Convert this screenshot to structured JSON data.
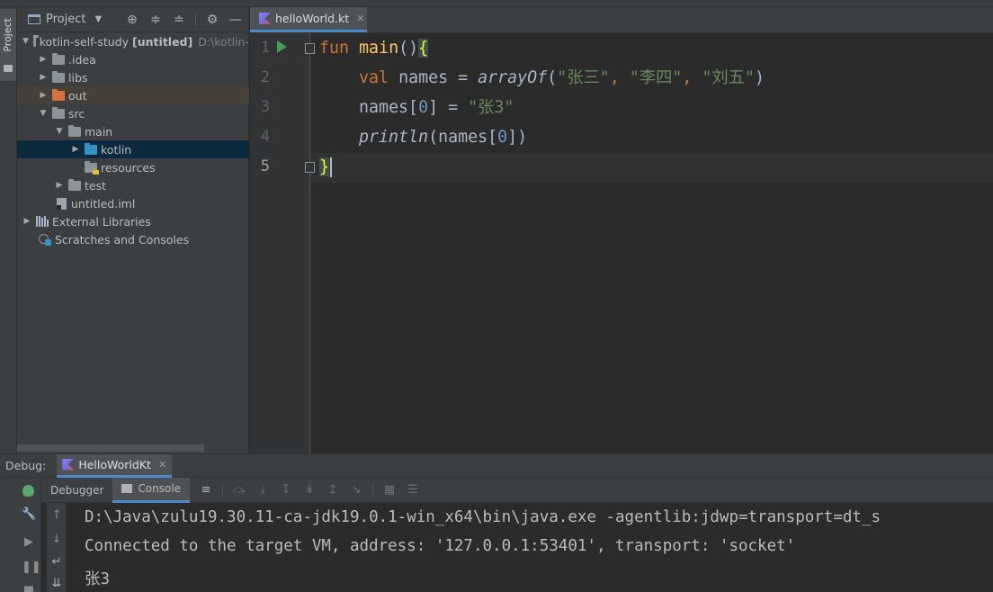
{
  "project_panel": {
    "title": "Project",
    "stripe_label": "Project",
    "tree": [
      {
        "label": "kotlin-self-study",
        "suffix": "[untitled]",
        "hint": "D:\\kotlin-"
      },
      {
        "label": ".idea"
      },
      {
        "label": "libs"
      },
      {
        "label": "out"
      },
      {
        "label": "src"
      },
      {
        "label": "main"
      },
      {
        "label": "kotlin"
      },
      {
        "label": "resources"
      },
      {
        "label": "test"
      },
      {
        "label": "untitled.iml"
      },
      {
        "label": "External Libraries"
      },
      {
        "label": "Scratches and Consoles"
      }
    ]
  },
  "editor": {
    "tab_label": "helloWorld.kt",
    "line_numbers": [
      "1",
      "2",
      "3",
      "4",
      "5"
    ],
    "code": {
      "l1": {
        "kw": "fun",
        "fn": "main",
        "parens": "()",
        "brace": "{"
      },
      "l2": {
        "kw": "val",
        "name": " names = ",
        "call": "arrayOf",
        "open": "(",
        "s1": "\"张三\"",
        "sep1": ", ",
        "s2": "\"李四\"",
        "sep2": ", ",
        "s3": "\"刘五\"",
        "close": ")"
      },
      "l3": {
        "left": "names[",
        "idx": "0",
        "mid": "] = ",
        "str": "\"张3\""
      },
      "l4": {
        "call": "println",
        "rest_open": "(names[",
        "idx": "0",
        "rest_close": "])"
      },
      "l5": {
        "brace": "}"
      }
    }
  },
  "debug": {
    "label": "Debug:",
    "session": "HelloWorldKt",
    "tabs": {
      "debugger": "Debugger",
      "console": "Console"
    },
    "console_lines": [
      "D:\\Java\\zulu19.30.11-ca-jdk19.0.1-win_x64\\bin\\java.exe -agentlib:jdwp=transport=dt_s",
      "Connected to the target VM, address: '127.0.0.1:53401', transport: 'socket'",
      "张3"
    ]
  },
  "colors": {
    "keyword": "#cc7832",
    "function": "#ffc66d",
    "string": "#6a8759",
    "number": "#6897bb",
    "accent": "#4a88c7"
  }
}
